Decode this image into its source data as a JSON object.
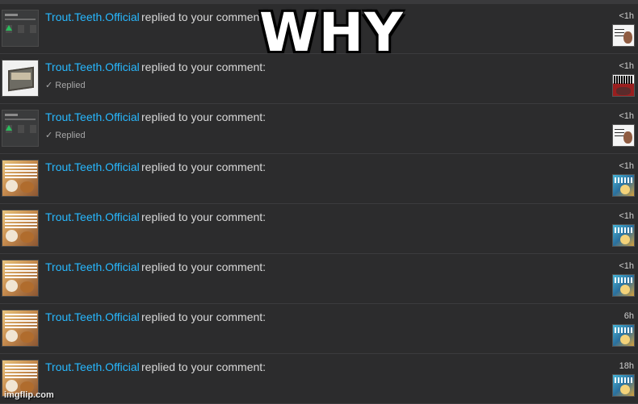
{
  "overlay_text": "WHY",
  "watermark": "imgflip.com",
  "accent_color": "#27b8ff",
  "notifications": [
    {
      "user": "Trout.Teeth.Official",
      "action": "replied to your comment",
      "status": "",
      "time": "<1h",
      "thumb": "ui-screenshot-thumbnail",
      "mini": "person-photo-thumbnail"
    },
    {
      "user": "Trout.Teeth.Official",
      "action": "replied to your comment:",
      "status": "✓ Replied",
      "time": "<1h",
      "thumb": "3d-model-thumbnail",
      "mini": "idiot-meme-thumbnail"
    },
    {
      "user": "Trout.Teeth.Official",
      "action": "replied to your comment:",
      "status": "✓ Replied",
      "time": "<1h",
      "thumb": "ui-screenshot-thumbnail",
      "mini": "person-photo-thumbnail"
    },
    {
      "user": "Trout.Teeth.Official",
      "action": "replied to your comment:",
      "status": "",
      "time": "<1h",
      "thumb": "meme-thumbnail",
      "mini": "blue-meme-thumbnail"
    },
    {
      "user": "Trout.Teeth.Official",
      "action": "replied to your comment:",
      "status": "",
      "time": "<1h",
      "thumb": "meme-thumbnail",
      "mini": "blue-meme-thumbnail"
    },
    {
      "user": "Trout.Teeth.Official",
      "action": "replied to your comment:",
      "status": "",
      "time": "<1h",
      "thumb": "meme-thumbnail",
      "mini": "blue-meme-thumbnail"
    },
    {
      "user": "Trout.Teeth.Official",
      "action": "replied to your comment:",
      "status": "",
      "time": "6h",
      "thumb": "meme-thumbnail",
      "mini": "blue-meme-thumbnail"
    },
    {
      "user": "Trout.Teeth.Official",
      "action": "replied to your comment:",
      "status": "",
      "time": "18h",
      "thumb": "meme-thumbnail",
      "mini": "blue-meme-thumbnail"
    }
  ]
}
